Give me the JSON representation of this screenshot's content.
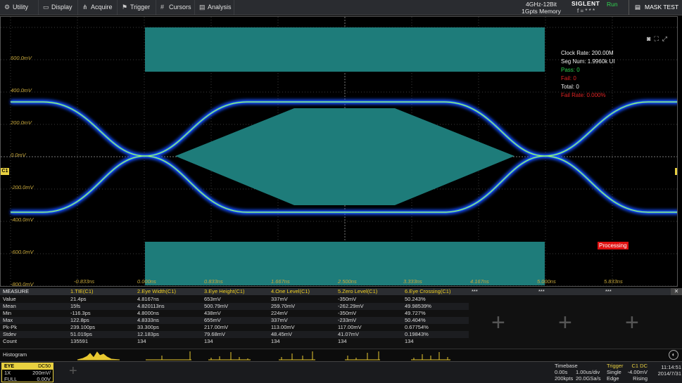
{
  "menubar": {
    "items": [
      {
        "icon": "utility-icon",
        "label": "Utility"
      },
      {
        "icon": "display-icon",
        "label": "Display"
      },
      {
        "icon": "acquire-icon",
        "label": "Acquire"
      },
      {
        "icon": "trigger-icon",
        "label": "Trigger"
      },
      {
        "icon": "cursors-icon",
        "label": "Cursors"
      },
      {
        "icon": "analysis-icon",
        "label": "Analysis"
      }
    ],
    "hw_line1": "4GHz-12Bit",
    "hw_line2": "1Gpts Memory",
    "brand": "SIGLENT",
    "run_state": "Run",
    "freq_status": "f = * * *",
    "mask_test_label": "MASK TEST"
  },
  "screen": {
    "y_labels": [
      "600.0mV",
      "400.0mV",
      "200.0mV",
      "0.0mV",
      "-200.0mV",
      "-400.0mV",
      "-600.0mV",
      "-800.0mV"
    ],
    "x_labels": [
      "-0.833ns",
      "0.000ns",
      "0.833ns",
      "1.667ns",
      "2.500ns",
      "3.333ns",
      "4.167ns",
      "5.000ns",
      "5.833ns"
    ],
    "channel_tag": "C1",
    "info": {
      "clock_rate": "Clock Rate: 200.00M",
      "seg_num": "Seg Num: 1.9960k UI",
      "pass": "Pass: 0",
      "fail": "Fail: 0",
      "total": "Total: 0",
      "fail_rate": "Fail Rate: 0.000%"
    },
    "processing": "Processing",
    "colors": {
      "mask": "#1e7c7a",
      "trace_core": "#f2ff3a",
      "trace_glow": "#1450ff",
      "grid": "#5a5a5a",
      "label": "#c8a83c"
    }
  },
  "measure": {
    "header_label": "MEASURE",
    "columns": [
      "1.TIE(C1)",
      "2.Eye Width(C1)",
      "3.Eye Height(C1)",
      "4.One Level(C1)",
      "5.Zero Level(C1)",
      "6.Eye Crossing(C1)"
    ],
    "empty_cols": [
      "***",
      "***",
      "***"
    ],
    "rows": [
      {
        "name": "Value",
        "vals": [
          "21.4ps",
          "4.8167ns",
          "653mV",
          "337mV",
          "-350mV",
          "50.243%"
        ]
      },
      {
        "name": "Mean",
        "vals": [
          "15fs",
          "4.820113ns",
          "500.79mV",
          "259.70mV",
          "-262.29mV",
          "49.98539%"
        ]
      },
      {
        "name": "Min",
        "vals": [
          "-116.3ps",
          "4.8000ns",
          "438mV",
          "224mV",
          "-350mV",
          "49.727%"
        ]
      },
      {
        "name": "Max",
        "vals": [
          "122.8ps",
          "4.8333ns",
          "655mV",
          "337mV",
          "-233mV",
          "50.404%"
        ]
      },
      {
        "name": "Pk-Pk",
        "vals": [
          "239.100ps",
          "33.300ps",
          "217.00mV",
          "113.00mV",
          "117.00mV",
          "0.67754%"
        ]
      },
      {
        "name": "Stdev",
        "vals": [
          "51.019ps",
          "12.183ps",
          "79.68mV",
          "48.45mV",
          "41.07mV",
          "0.19843%"
        ]
      },
      {
        "name": "Count",
        "vals": [
          "135591",
          "134",
          "134",
          "134",
          "134",
          "134"
        ]
      }
    ],
    "histogram_label": "Histogram"
  },
  "bottom": {
    "channel": {
      "mode": "EYE",
      "coupling": "DC50",
      "probe": "1X",
      "scale": "200mV/",
      "bw": "FULL",
      "offset": "0.00V"
    },
    "timebase": {
      "title": "Timebase",
      "delay": "0.00s",
      "scale": "1.00us/div",
      "points": "200kpts",
      "rate": "20.0GSa/s"
    },
    "trigger": {
      "title": "Trigger",
      "source": "C1 DC",
      "mode": "Single",
      "level": "-4.00mV",
      "type": "Edge",
      "slope": "Rising"
    },
    "time": "11:14:51",
    "date": "2014/7/31"
  }
}
